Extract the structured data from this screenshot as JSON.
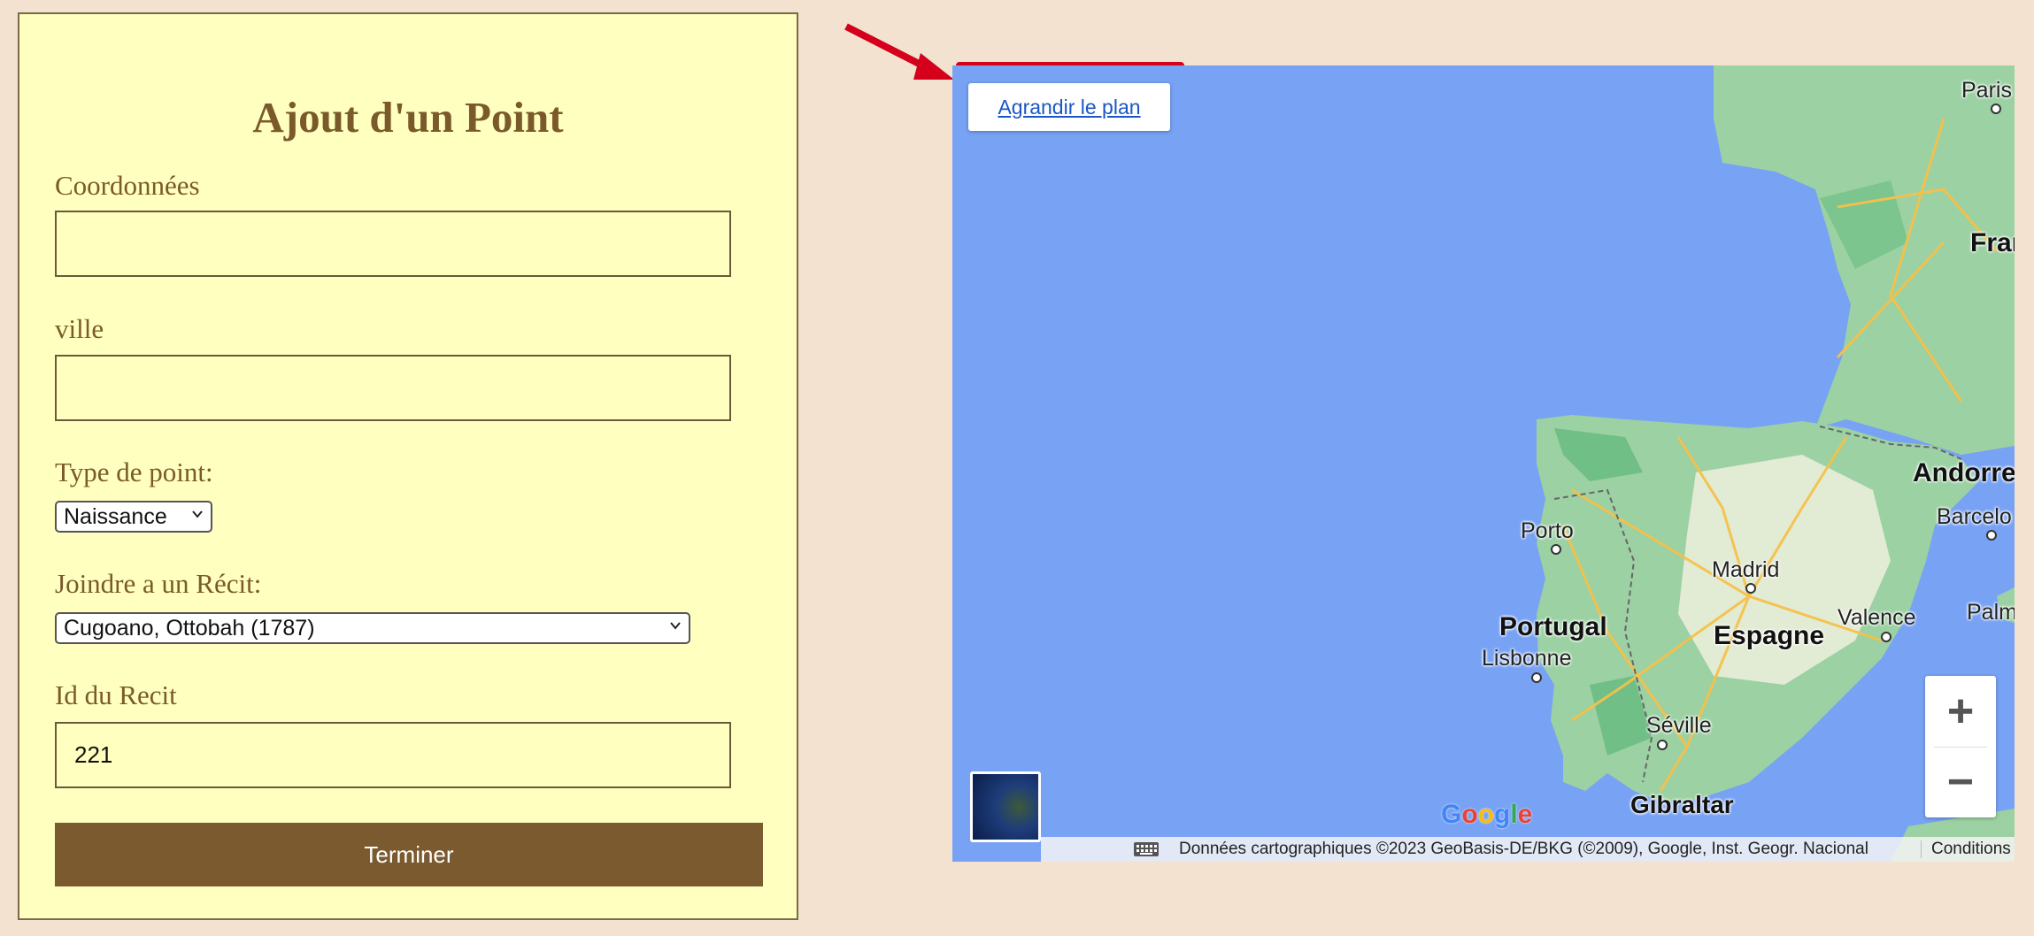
{
  "form": {
    "title": "Ajout d'un Point",
    "coords_label": "Coordonnées",
    "coords_value": "",
    "city_label": "ville",
    "city_value": "",
    "type_label": "Type de point:",
    "type_selected": "Naissance",
    "recit_label": "Joindre a un Récit:",
    "recit_selected": "Cugoano, Ottobah (1787)",
    "recit_id_label": "Id du Recit",
    "recit_id_value": "221",
    "submit_label": "Terminer"
  },
  "map": {
    "enlarge_label": "Agrandir le plan",
    "cities": {
      "paris": "Paris",
      "porto": "Porto",
      "madrid": "Madrid",
      "lisbonne": "Lisbonne",
      "valence": "Valence",
      "seville": "Séville",
      "barcelo": "Barcelo",
      "palm": "Palm",
      "gibraltar": "Gibraltar"
    },
    "countries": {
      "portugal": "Portugal",
      "espagne": "Espagne",
      "france": "Fran",
      "andorre": "Andorre"
    },
    "zoom_in": "+",
    "zoom_out": "−",
    "attribution": "Données cartographiques ©2023 GeoBasis-DE/BKG (©2009), Google, Inst. Geogr. Nacional",
    "terms": "Conditions d'utilisation",
    "google_logo": "Google",
    "icons": [
      "keyboard-icon",
      "layer-thumbnail"
    ]
  },
  "colors": {
    "background": "#f2e2cf",
    "panel": "#ffffbf",
    "accent": "#7a5a2e",
    "water": "#78a2f4",
    "land": "#9cd1a3",
    "highlight": "#d4001c"
  }
}
